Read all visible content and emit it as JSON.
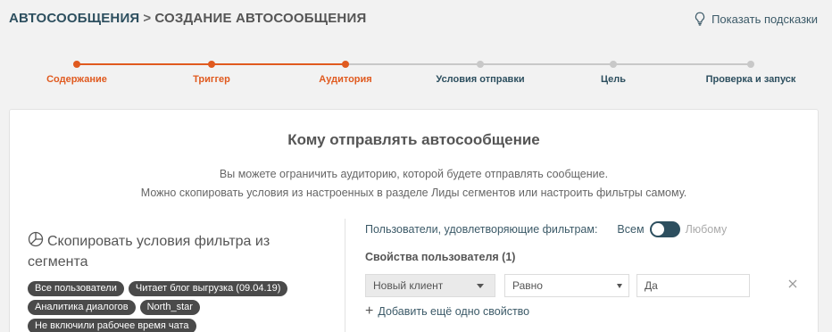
{
  "header": {
    "root": "АВТОСООБЩЕНИЯ",
    "separator": ">",
    "current": "СОЗДАНИЕ АВТОСООБЩЕНИЯ",
    "hints_label": "Показать подсказки",
    "hints_icon": "lightbulb-icon"
  },
  "stepper": {
    "active_color": "#e05a1f",
    "inactive_color": "#c8c8c8",
    "steps": [
      {
        "label": "Содержание",
        "done": true
      },
      {
        "label": "Триггер",
        "done": true
      },
      {
        "label": "Аудитория",
        "done": true
      },
      {
        "label": "Условия отправки",
        "done": false
      },
      {
        "label": "Цель",
        "done": false
      },
      {
        "label": "Проверка и запуск",
        "done": false
      }
    ]
  },
  "card": {
    "title": "Кому отправлять автосообщение",
    "desc_line1": "Вы можете ограничить аудиторию, которой будете отправлять сообщение.",
    "desc_line2": "Можно скопировать условия из настроенных в разделе Лиды сегментов или настроить фильтры самому."
  },
  "segments": {
    "icon": "pie-chart-icon",
    "title": "Скопировать условия фильтра из сегмента",
    "chips": [
      "Все пользователи",
      "Читает блог выгрузка (09.04.19)",
      "Аналитика диалогов",
      "North_star",
      "Не включили рабочее время чата"
    ]
  },
  "filters": {
    "label": "Пользователи, удовлетворяющие фильтрам:",
    "all_label": "Всем",
    "any_label": "Любому",
    "toggle_color": "#2d4f5f",
    "props_title": "Свойства пользователя (1)",
    "property": "Новый клиент",
    "operator": "Равно",
    "value": "Да",
    "add_label": "Добавить ещё одно свойство"
  }
}
